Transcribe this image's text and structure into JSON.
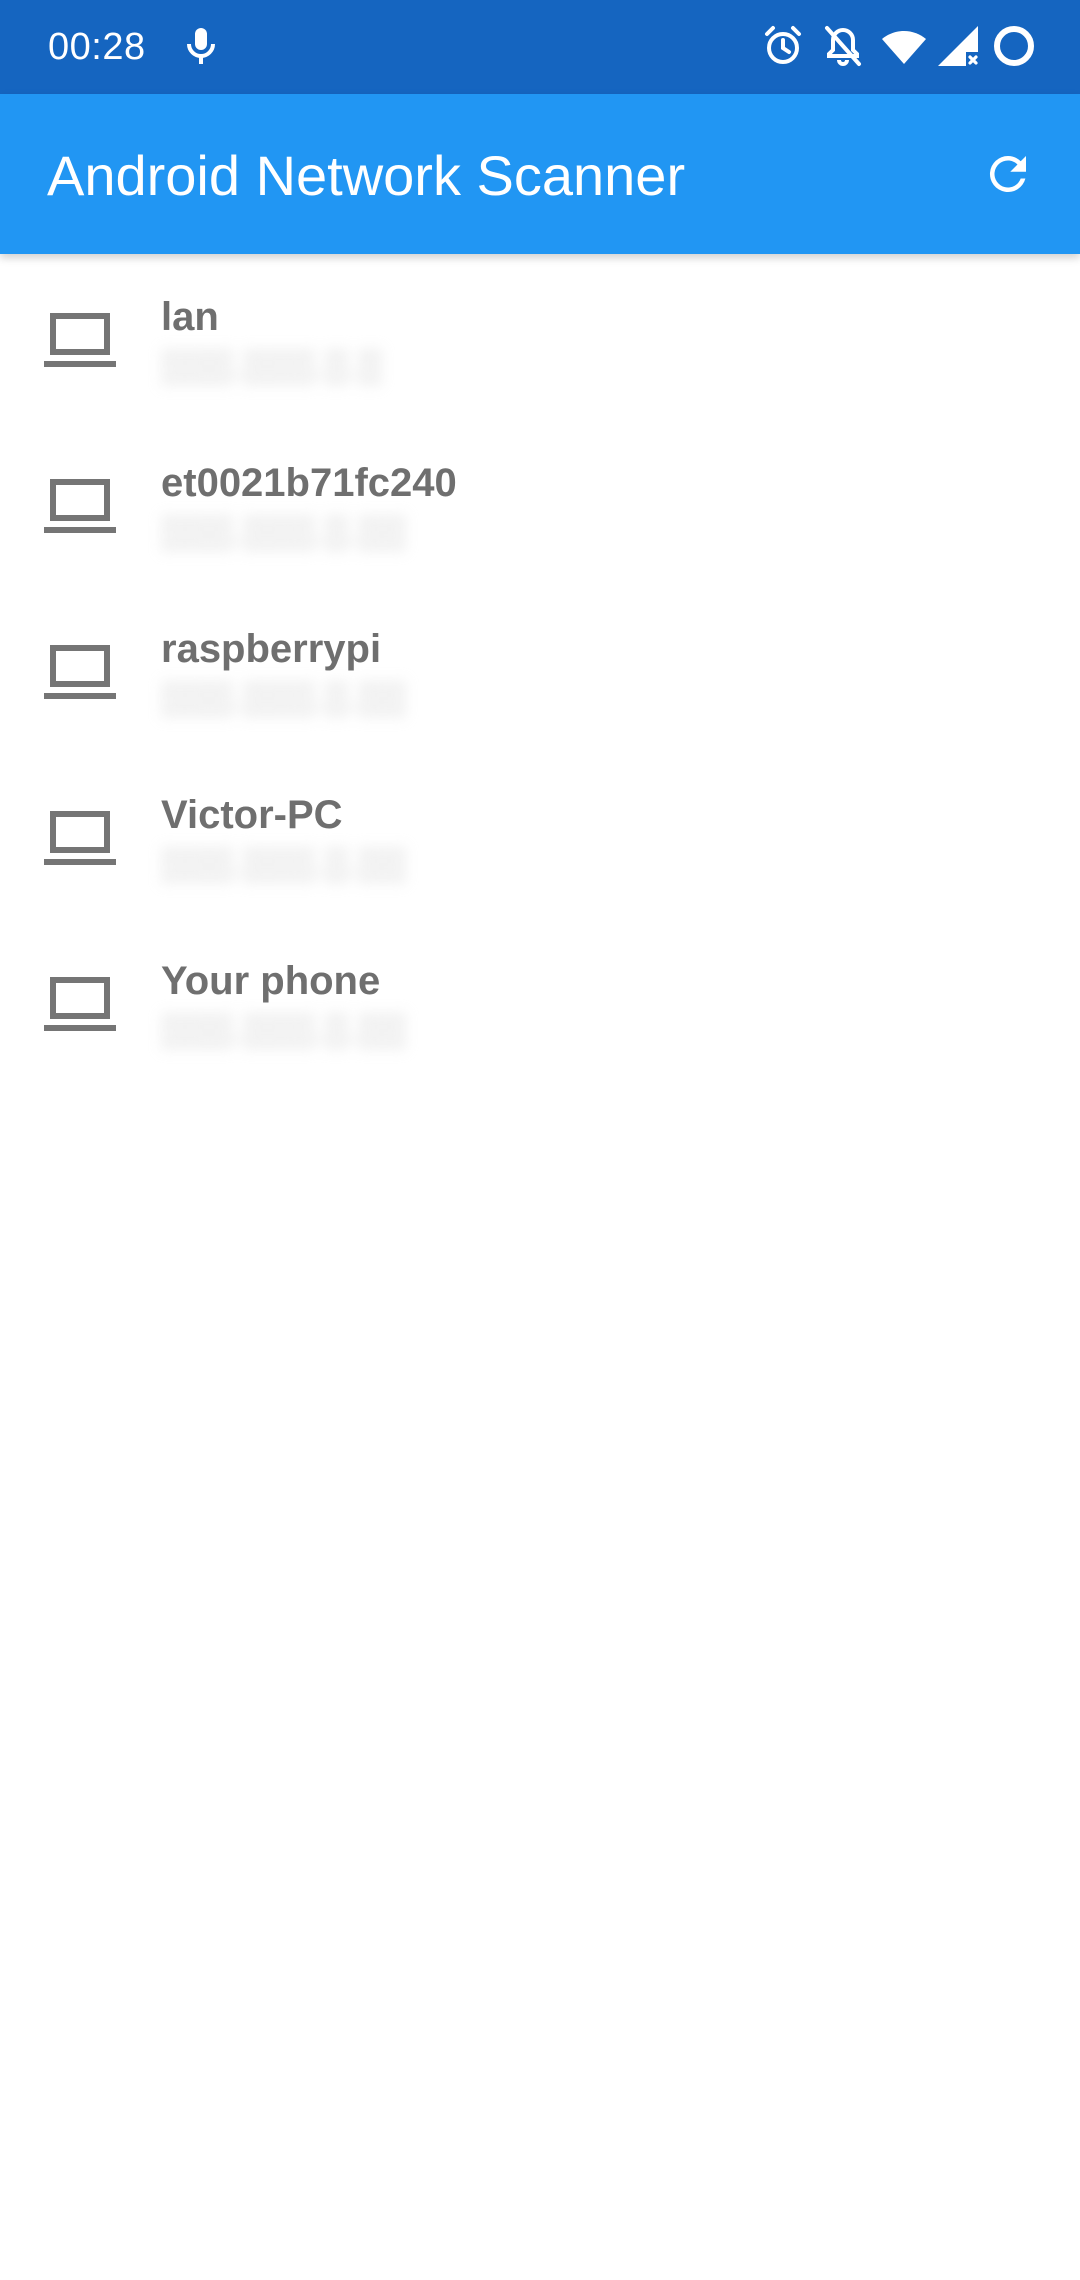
{
  "status_bar": {
    "time": "00:28",
    "icons": [
      "mic-icon",
      "alarm-icon",
      "notifications-off-icon",
      "wifi-icon",
      "cellular-signal-icon",
      "battery-ring-icon"
    ]
  },
  "app_bar": {
    "title": "Android Network Scanner",
    "refresh_icon": "refresh-icon"
  },
  "devices": [
    {
      "name": "lan",
      "icon": "laptop-icon"
    },
    {
      "name": "et0021b71fc240",
      "icon": "laptop-icon"
    },
    {
      "name": "raspberrypi",
      "icon": "laptop-icon"
    },
    {
      "name": "Victor-PC",
      "icon": "laptop-icon"
    },
    {
      "name": "Your phone",
      "icon": "laptop-icon"
    }
  ],
  "colors": {
    "status_bar": "#1565C0",
    "app_bar": "#2196F3",
    "text_primary": "#6f6f6f",
    "icon": "#757575"
  }
}
